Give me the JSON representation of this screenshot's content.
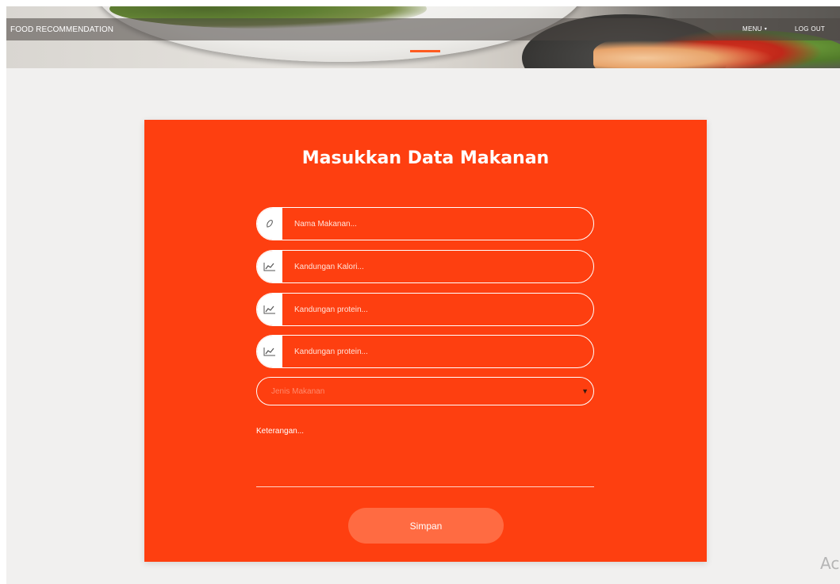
{
  "header": {
    "brand": "FOOD RECOMMENDATION",
    "menu_label": "MENU",
    "logout_label": "LOG OUT"
  },
  "form": {
    "title": "Masukkan Data Makanan",
    "fields": [
      {
        "icon": "food-icon",
        "placeholder": "Nama Makanan..."
      },
      {
        "icon": "chart-icon",
        "placeholder": "Kandungan Kalori..."
      },
      {
        "icon": "chart-icon",
        "placeholder": "Kandungan protein..."
      },
      {
        "icon": "chart-icon",
        "placeholder": "Kandungan protein..."
      }
    ],
    "select_label": "Jenis Makanan",
    "textarea_label": "Keterangan...",
    "submit_label": "Simpan"
  },
  "watermark": {
    "text": "Ac"
  },
  "colors": {
    "accent": "#fe3f10",
    "button": "#ff6b42",
    "background": "#f1f0ef"
  }
}
